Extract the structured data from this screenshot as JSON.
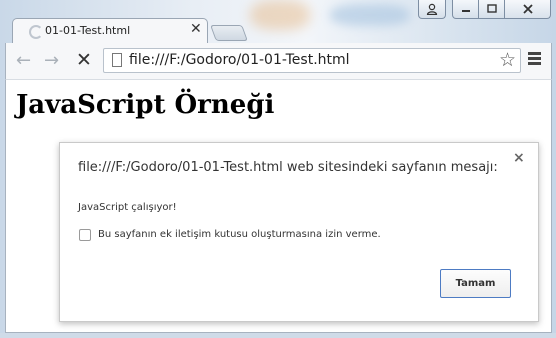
{
  "window": {
    "caption_buttons": [
      "user-icon",
      "minimize-icon",
      "maximize-icon",
      "close-icon"
    ]
  },
  "tab": {
    "title": "01-01-Test.html",
    "close_glyph": "✕",
    "loading": true
  },
  "toolbar": {
    "back_glyph": "←",
    "forward_glyph": "→",
    "stop_glyph": "✕",
    "url": "file:///F:/Godoro/01-01-Test.html",
    "star_glyph": "☆"
  },
  "page": {
    "heading": "JavaScript Örneği"
  },
  "dialog": {
    "title": "file:///F:/Godoro/01-01-Test.html web sitesindeki sayfanın mesajı:",
    "close_glyph": "×",
    "message": "JavaScript çalışıyor!",
    "checkbox_label": "Bu sayfanın ek iletişim kutusu oluşturmasına izin verme.",
    "checkbox_checked": false,
    "ok_label": "Tamam"
  },
  "colors": {
    "accent": "#4d7bc3",
    "frame": "#dbe6f1"
  }
}
